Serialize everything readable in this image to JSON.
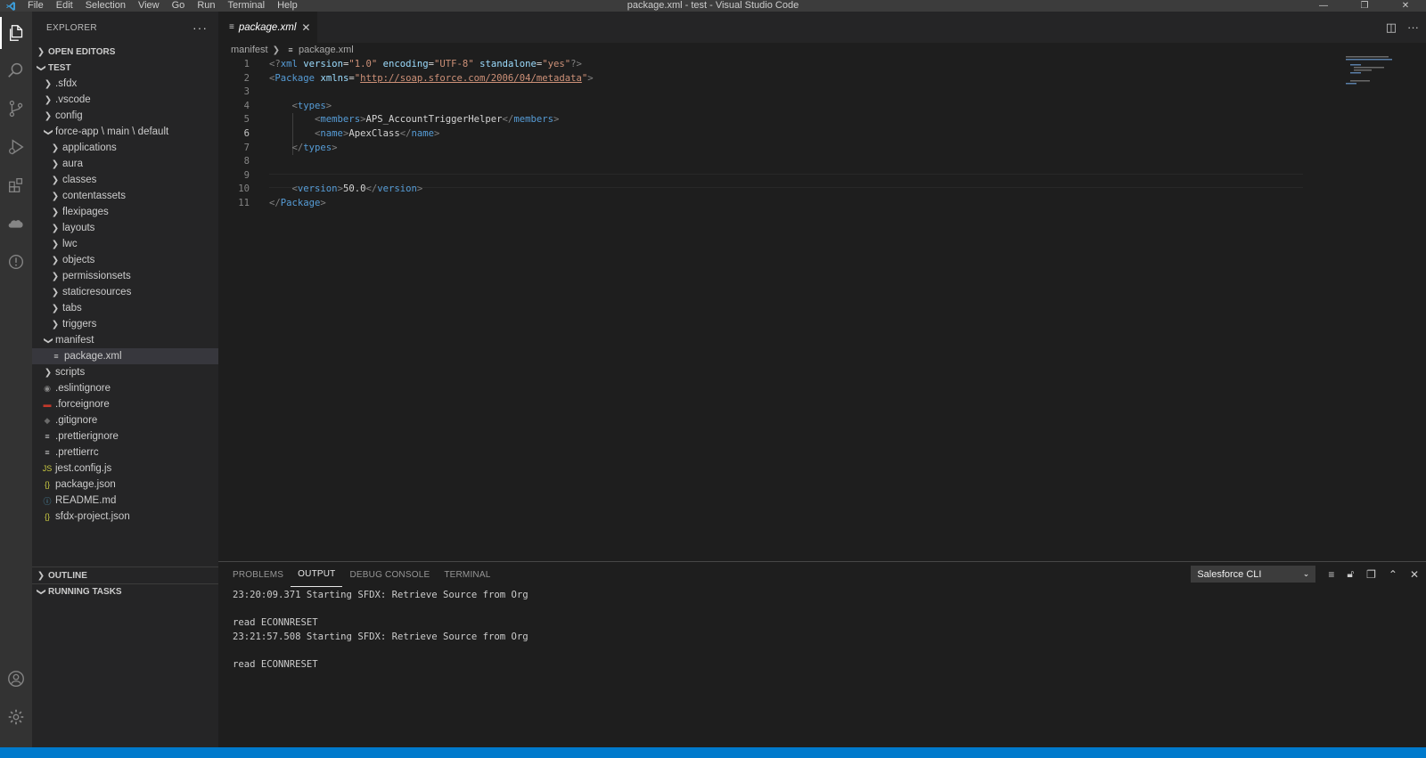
{
  "window": {
    "title": "package.xml - test - Visual Studio Code",
    "menu": [
      "File",
      "Edit",
      "Selection",
      "View",
      "Go",
      "Run",
      "Terminal",
      "Help"
    ]
  },
  "sidebar": {
    "title": "EXPLORER",
    "open_editors": "OPEN EDITORS",
    "workspace": "TEST",
    "tree": [
      {
        "label": ".sfdx",
        "type": "folder",
        "depth": 1,
        "open": false
      },
      {
        "label": ".vscode",
        "type": "folder",
        "depth": 1,
        "open": false
      },
      {
        "label": "config",
        "type": "folder",
        "depth": 1,
        "open": false
      },
      {
        "label": "force-app \\ main \\ default",
        "type": "folder",
        "depth": 1,
        "open": true
      },
      {
        "label": "applications",
        "type": "folder",
        "depth": 2,
        "open": false
      },
      {
        "label": "aura",
        "type": "folder",
        "depth": 2,
        "open": false
      },
      {
        "label": "classes",
        "type": "folder",
        "depth": 2,
        "open": false
      },
      {
        "label": "contentassets",
        "type": "folder",
        "depth": 2,
        "open": false
      },
      {
        "label": "flexipages",
        "type": "folder",
        "depth": 2,
        "open": false
      },
      {
        "label": "layouts",
        "type": "folder",
        "depth": 2,
        "open": false
      },
      {
        "label": "lwc",
        "type": "folder",
        "depth": 2,
        "open": false
      },
      {
        "label": "objects",
        "type": "folder",
        "depth": 2,
        "open": false
      },
      {
        "label": "permissionsets",
        "type": "folder",
        "depth": 2,
        "open": false
      },
      {
        "label": "staticresources",
        "type": "folder",
        "depth": 2,
        "open": false
      },
      {
        "label": "tabs",
        "type": "folder",
        "depth": 2,
        "open": false
      },
      {
        "label": "triggers",
        "type": "folder",
        "depth": 2,
        "open": false
      },
      {
        "label": "manifest",
        "type": "folder",
        "depth": 1,
        "open": true
      },
      {
        "label": "package.xml",
        "type": "file",
        "depth": 2,
        "icon": "lines-icon",
        "iconColor": "#cccccc",
        "selected": true
      },
      {
        "label": "scripts",
        "type": "folder",
        "depth": 1,
        "open": false
      },
      {
        "label": ".eslintignore",
        "type": "file",
        "depth": 1,
        "icon": "eslint-icon",
        "iconColor": "#8a8a8a"
      },
      {
        "label": ".forceignore",
        "type": "file",
        "depth": 1,
        "icon": "forceignore-icon",
        "iconColor": "#c0392b"
      },
      {
        "label": ".gitignore",
        "type": "file",
        "depth": 1,
        "icon": "git-icon",
        "iconColor": "#6a6a6a"
      },
      {
        "label": ".prettierignore",
        "type": "file",
        "depth": 1,
        "icon": "lines-icon",
        "iconColor": "#cccccc"
      },
      {
        "label": ".prettierrc",
        "type": "file",
        "depth": 1,
        "icon": "lines-icon",
        "iconColor": "#cccccc"
      },
      {
        "label": "jest.config.js",
        "type": "file",
        "depth": 1,
        "icon": "js-icon",
        "iconColor": "#cbcb41"
      },
      {
        "label": "package.json",
        "type": "file",
        "depth": 1,
        "icon": "json-icon",
        "iconColor": "#cbcb41"
      },
      {
        "label": "README.md",
        "type": "file",
        "depth": 1,
        "icon": "info-icon",
        "iconColor": "#519aba"
      },
      {
        "label": "sfdx-project.json",
        "type": "file",
        "depth": 1,
        "icon": "json-icon",
        "iconColor": "#cbcb41"
      }
    ],
    "outline": "OUTLINE",
    "running_tasks": "RUNNING TASKS"
  },
  "editor": {
    "tab_label": "package.xml",
    "breadcrumb": [
      "manifest",
      "package.xml"
    ],
    "current_line": 6,
    "lines": [
      {
        "n": "1",
        "tokens": [
          [
            "t-tag",
            "<?"
          ],
          [
            "t-name",
            "xml"
          ],
          [
            "t-text",
            " "
          ],
          [
            "t-attr",
            "version"
          ],
          [
            "t-text",
            "="
          ],
          [
            "t-str",
            "\"1.0\""
          ],
          [
            "t-text",
            " "
          ],
          [
            "t-attr",
            "encoding"
          ],
          [
            "t-text",
            "="
          ],
          [
            "t-str",
            "\"UTF-8\""
          ],
          [
            "t-text",
            " "
          ],
          [
            "t-attr",
            "standalone"
          ],
          [
            "t-text",
            "="
          ],
          [
            "t-str",
            "\"yes\""
          ],
          [
            "t-tag",
            "?>"
          ]
        ]
      },
      {
        "n": "2",
        "tokens": [
          [
            "t-tag",
            "<"
          ],
          [
            "t-name",
            "Package"
          ],
          [
            "t-text",
            " "
          ],
          [
            "t-attr",
            "xmlns"
          ],
          [
            "t-text",
            "="
          ],
          [
            "t-str",
            "\""
          ],
          [
            "t-url",
            "http://soap.sforce.com/2006/04/metadata"
          ],
          [
            "t-str",
            "\""
          ],
          [
            "t-tag",
            ">"
          ]
        ]
      },
      {
        "n": "3",
        "tokens": []
      },
      {
        "n": "4",
        "tokens": [
          [
            "t-text",
            "    "
          ],
          [
            "t-tag",
            "<"
          ],
          [
            "t-name",
            "types"
          ],
          [
            "t-tag",
            ">"
          ]
        ]
      },
      {
        "n": "5",
        "tokens": [
          [
            "t-text",
            "        "
          ],
          [
            "t-tag",
            "<"
          ],
          [
            "t-name",
            "members"
          ],
          [
            "t-tag",
            ">"
          ],
          [
            "t-text",
            "APS_AccountTriggerHelper"
          ],
          [
            "t-tag",
            "</"
          ],
          [
            "t-name",
            "members"
          ],
          [
            "t-tag",
            ">"
          ]
        ]
      },
      {
        "n": "6",
        "tokens": [
          [
            "t-text",
            "        "
          ],
          [
            "t-tag",
            "<"
          ],
          [
            "t-name",
            "name"
          ],
          [
            "t-tag",
            ">"
          ],
          [
            "t-text",
            "ApexClass"
          ],
          [
            "t-tag",
            "</"
          ],
          [
            "t-name",
            "name"
          ],
          [
            "t-tag",
            ">"
          ]
        ]
      },
      {
        "n": "7",
        "tokens": [
          [
            "t-text",
            "    "
          ],
          [
            "t-tag",
            "</"
          ],
          [
            "t-name",
            "types"
          ],
          [
            "t-tag",
            ">"
          ]
        ]
      },
      {
        "n": "8",
        "tokens": []
      },
      {
        "n": "9",
        "tokens": []
      },
      {
        "n": "10",
        "tokens": [
          [
            "t-text",
            "    "
          ],
          [
            "t-tag",
            "<"
          ],
          [
            "t-name",
            "version"
          ],
          [
            "t-tag",
            ">"
          ],
          [
            "t-text",
            "50.0"
          ],
          [
            "t-tag",
            "</"
          ],
          [
            "t-name",
            "version"
          ],
          [
            "t-tag",
            ">"
          ]
        ]
      },
      {
        "n": "11",
        "tokens": [
          [
            "t-tag",
            "</"
          ],
          [
            "t-name",
            "Package"
          ],
          [
            "t-tag",
            ">"
          ]
        ]
      }
    ]
  },
  "panel": {
    "tabs": [
      "PROBLEMS",
      "OUTPUT",
      "DEBUG CONSOLE",
      "TERMINAL"
    ],
    "active_tab": "OUTPUT",
    "channel": "Salesforce CLI",
    "output_lines": [
      "23:20:09.371 Starting SFDX: Retrieve Source from Org",
      "",
      "read ECONNRESET",
      "23:21:57.508 Starting SFDX: Retrieve Source from Org",
      "",
      "read ECONNRESET"
    ]
  },
  "colors": {
    "accent": "#007acc",
    "activity_bar": "#333333",
    "sidebar": "#252526",
    "editor": "#1e1e1e"
  }
}
